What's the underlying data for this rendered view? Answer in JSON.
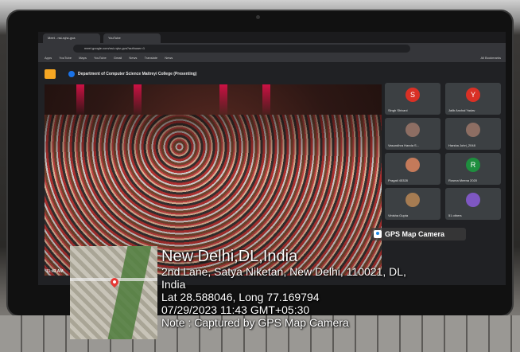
{
  "browser": {
    "tabs": [
      {
        "label": "Meet - nsi-rqhz-gva"
      },
      {
        "label": "YouTube"
      }
    ],
    "address": "meet.google.com/nsi-rqhz-gva?authuser=1",
    "bookmarks": [
      "Apps",
      "YouTube",
      "Maps",
      "YouTube",
      "Gmail",
      "News",
      "Translate",
      "News"
    ],
    "all_bookmarks": "All Bookmarks"
  },
  "meet": {
    "presenting_title": "Department of Computer Science Maitreyi College (Presenting)",
    "time": "11:43 AM",
    "participants": [
      {
        "initial": "S",
        "name": "Singh Shivani",
        "color": "#d93025"
      },
      {
        "initial": "Y",
        "name": "Jalib Anchal Yadav",
        "color": "#d93025"
      },
      {
        "initial": "",
        "name": "Vasundhra Handa S...",
        "color": "#8d6e63"
      },
      {
        "initial": "",
        "name": "Harsha Johri_2048",
        "color": "#8d6e63"
      },
      {
        "initial": "",
        "name": "Pragati 45328",
        "color": "#c47a5a"
      },
      {
        "initial": "R",
        "name": "Rosma Meena 2020",
        "color": "#1e8e3e"
      },
      {
        "initial": "",
        "name": "Vinisha Gupta",
        "color": "#a67c52"
      },
      {
        "initial": "",
        "name": "51 others",
        "color": "#7e57c2"
      }
    ]
  },
  "gps": {
    "app_label": "GPS Map Camera",
    "location_title": "New Delhi,DL,India",
    "address_line1": "2nd Lane, Satya Niketan, New Delhi, 110021, DL,",
    "address_line2": "India",
    "coordinates": "Lat 28.588046, Long 77.169794",
    "datetime": "07/29/2023 11:43 GMT+05:30",
    "note": "Note : Captured by GPS Map Camera"
  }
}
